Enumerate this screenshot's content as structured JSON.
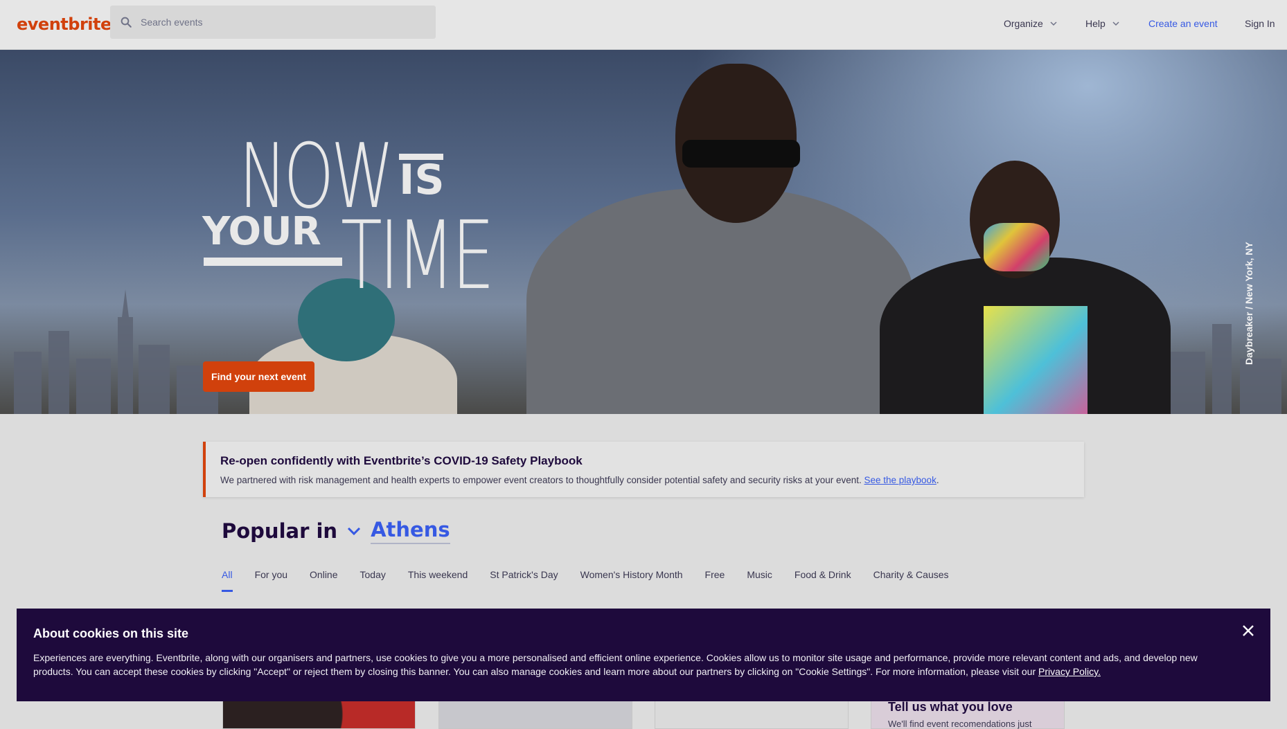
{
  "header": {
    "logo": "eventbrite",
    "search_placeholder": "Search events",
    "nav": {
      "organize": "Organize",
      "help": "Help",
      "create": "Create an event",
      "signin": "Sign In"
    }
  },
  "hero": {
    "title_now": "NOW",
    "title_is": "IS",
    "title_your": "YOUR",
    "title_time": "TIME",
    "cta": "Find your next event",
    "credit": "Daybreaker / New York, NY"
  },
  "covid": {
    "title": "Re-open confidently with Eventbrite’s COVID-19 Safety Playbook",
    "body": "We partnered with risk management and health experts to empower event creators to thoughtfully consider potential safety and security risks at your event. ",
    "link": "See the playbook",
    "suffix": "."
  },
  "popular": {
    "label": "Popular in",
    "city": "Athens",
    "tabs": [
      "All",
      "For you",
      "Online",
      "Today",
      "This weekend",
      "St Patrick's Day",
      "Women's History Month",
      "Free",
      "Music",
      "Food & Drink",
      "Charity & Causes"
    ],
    "active_tab": "All"
  },
  "cards": {
    "promo_title": "Tell us what you love",
    "promo_text": "We'll find event recomendations just"
  },
  "cookie": {
    "title": "About cookies on this site",
    "text": "Experiences are everything. Eventbrite, along with our organisers and partners, use cookies to give you a more personalised and efficient online experience. Cookies allow us to monitor site usage and performance, provide more relevant content and ads, and develop new products. You can accept these cookies by clicking \"Accept\" or reject them by closing this banner. You can also manage cookies and learn more about our partners by clicking on \"Cookie Settings\". For more information, please visit our ",
    "link": "Privacy Policy."
  },
  "colors": {
    "brand": "#d1410c",
    "link": "#3659e3",
    "cookie_bg": "#1e0a3c"
  },
  "icons": [
    "search-icon",
    "chevron-down-icon",
    "close-icon"
  ]
}
